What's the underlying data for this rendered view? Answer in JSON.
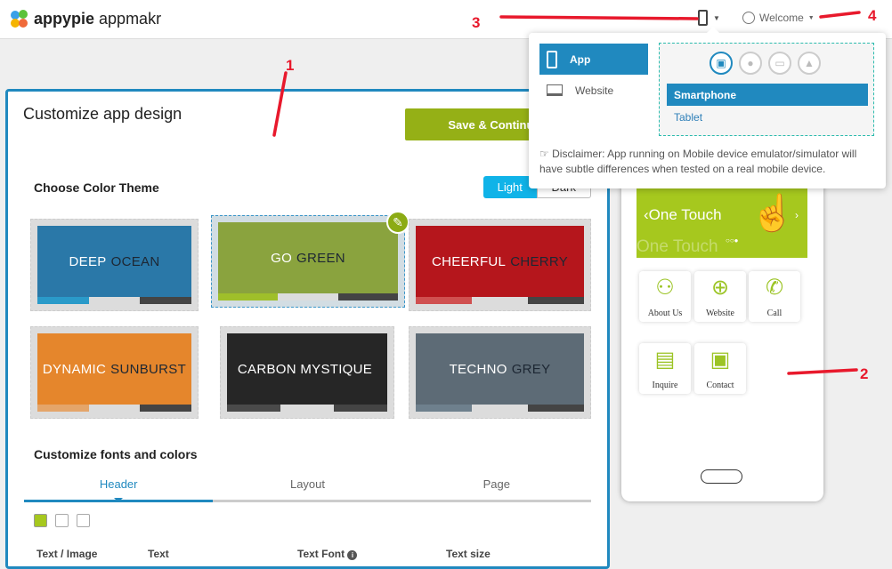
{
  "header": {
    "logo_brand": "appypie",
    "logo_product": "appmakr",
    "device_icon": "smartphone-icon",
    "welcome": "Welcome"
  },
  "panel": {
    "title": "Customize app design",
    "save_label": "Save & Continue",
    "theme_heading": "Choose Color Theme",
    "toggle": {
      "light": "Light",
      "dark": "Dark",
      "selected": "Light"
    },
    "themes": [
      {
        "w1": "DEEP",
        "w2": "OCEAN",
        "bg": "#2a78a8",
        "c1": "#2a9ac9",
        "selected": false
      },
      {
        "w1": "GO",
        "w2": "GREEN",
        "bg": "#8aa33e",
        "c1": "#9fbf2a",
        "selected": true
      },
      {
        "w1": "CHEERFUL",
        "w2": "CHERRY",
        "bg": "#b5161c",
        "c1": "#d05050",
        "selected": false
      },
      {
        "w1": "DYNAMIC",
        "w2": "SUNBURST",
        "bg": "#e5862c",
        "c1": "#e4a56a",
        "selected": false
      },
      {
        "w1": "CARBON MYSTIQUE",
        "w2": "",
        "bg": "#262626",
        "c1": "#4a4a4a",
        "selected": false
      },
      {
        "w1": "TECHNO",
        "w2": "GREY",
        "bg": "#5d6b76",
        "c1": "#6e808d",
        "selected": false
      }
    ],
    "fonts_heading": "Customize fonts and colors",
    "tabs": [
      "Header",
      "Layout",
      "Page"
    ],
    "active_tab": "Header",
    "columns": [
      "Text / Image",
      "Text",
      "Text Font",
      "Text size"
    ]
  },
  "preview": {
    "banner_text": "One Touch",
    "banner_ghost": "One Touch",
    "tiles": [
      {
        "label": "About Us",
        "icon": "person-icon"
      },
      {
        "label": "Website",
        "icon": "globe-icon"
      },
      {
        "label": "Call",
        "icon": "phone-icon"
      },
      {
        "label": "Inquire",
        "icon": "document-icon"
      },
      {
        "label": "Contact",
        "icon": "contact-book-icon"
      }
    ]
  },
  "popup": {
    "platforms": [
      "App",
      "Website"
    ],
    "selected_platform": "App",
    "os_icons": [
      "android-icon",
      "apple-icon",
      "laptop-icon",
      "warning-icon"
    ],
    "devices": [
      "Smartphone",
      "Tablet"
    ],
    "selected_device": "Smartphone",
    "disclaimer": "Disclaimer: App running on Mobile device emulator/simulator will have subtle differences when tested on a real mobile device."
  },
  "annotations": [
    "1",
    "2",
    "3",
    "4"
  ],
  "colors": {
    "primary": "#2089bf",
    "accent_green": "#95b016",
    "annotation": "#e8192c"
  }
}
